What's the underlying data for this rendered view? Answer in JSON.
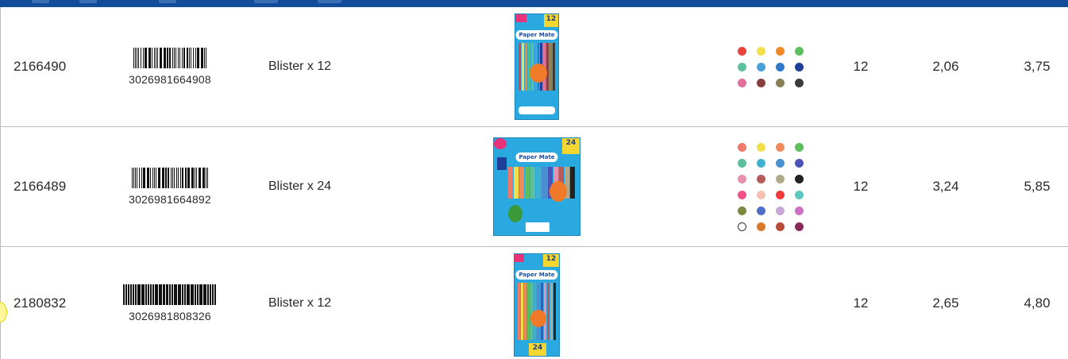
{
  "rows": [
    {
      "ref": "2166490",
      "ean": "3026981664908",
      "description": "Blister x 12",
      "qty": "12",
      "price_ht": "2,06",
      "price_ttc": "3,75",
      "colors": [
        "#e8433a",
        "#f2e04a",
        "#f08a24",
        "#5cbf5c",
        "#5cbfa0",
        "#4aa0d8",
        "#2f79c8",
        "#1e3f9a",
        "#e0709a",
        "#8a3f3f",
        "#8a8056",
        "#3b3b3b"
      ],
      "pack": {
        "size": "12",
        "brand": "Paper Mate"
      }
    },
    {
      "ref": "2166489",
      "ean": "3026981664892",
      "description": "Blister x 24",
      "qty": "12",
      "price_ht": "3,24",
      "price_ttc": "5,85",
      "colors": [
        "#ef7a6a",
        "#f2e04a",
        "#f08a5a",
        "#5cbf5c",
        "#5cbfa0",
        "#3fb0d0",
        "#4a8fd0",
        "#4a54b8",
        "#e890b0",
        "#b85a5a",
        "#b0a98a",
        "#222222",
        "#f0508a",
        "#f8c0b0",
        "#ee3a3a",
        "#5cc8c0",
        "#7a8a40",
        "#5070c8",
        "#c8a8d8",
        "#d070c0",
        "#ffffff",
        "#d87a2a",
        "#b84a3a",
        "#8a2a5a"
      ],
      "pack": {
        "size": "24",
        "brand": "Paper Mate"
      }
    },
    {
      "ref": "2180832",
      "ean": "3026981808326",
      "description": "Blister x 12",
      "qty": "12",
      "price_ht": "2,65",
      "price_ttc": "4,80",
      "colors": [],
      "pack": {
        "size": "12",
        "brand": "Paper Mate",
        "bottom_badge": "24"
      }
    }
  ]
}
